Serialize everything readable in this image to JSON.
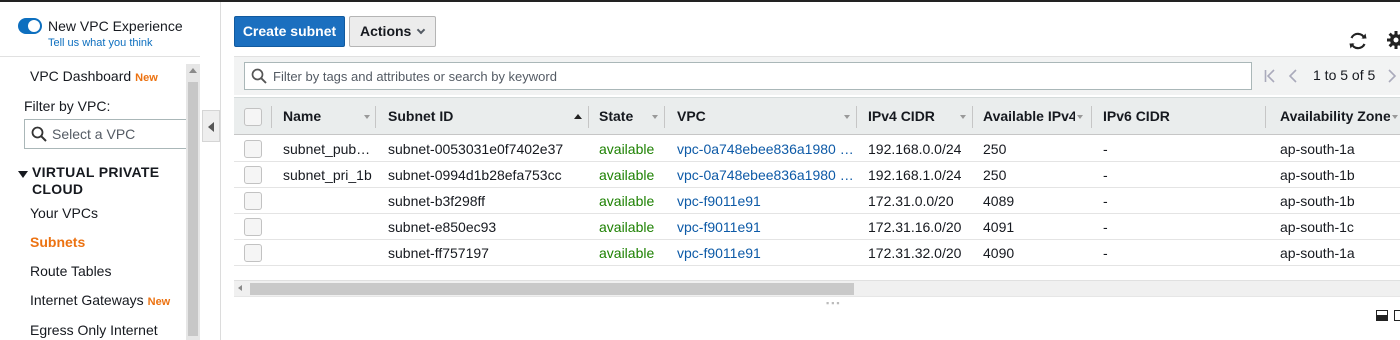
{
  "experience": {
    "title": "New VPC Experience",
    "feedback": "Tell us what you think"
  },
  "sidebar": {
    "dashboard": "VPC Dashboard",
    "dashboard_badge": "New",
    "filter_label": "Filter by VPC:",
    "filter_placeholder": "Select a VPC",
    "section": "VIRTUAL PRIVATE CLOUD",
    "items": [
      {
        "label": "Your VPCs",
        "badge": ""
      },
      {
        "label": "Subnets",
        "badge": "",
        "active": true
      },
      {
        "label": "Route Tables",
        "badge": ""
      },
      {
        "label": "Internet Gateways",
        "badge": "New"
      },
      {
        "label": "Egress Only Internet",
        "badge": ""
      }
    ]
  },
  "toolbar": {
    "create_label": "Create subnet",
    "actions_label": "Actions"
  },
  "search": {
    "placeholder": "Filter by tags and attributes or search by keyword"
  },
  "pagination": {
    "text": "1 to 5 of 5"
  },
  "table": {
    "columns": [
      "Name",
      "Subnet ID",
      "State",
      "VPC",
      "IPv4 CIDR",
      "Available IPv4",
      "IPv6 CIDR",
      "Availability Zone"
    ],
    "rows": [
      {
        "name": "subnet_pub…",
        "subnet_id": "subnet-0053031e0f7402e37",
        "state": "available",
        "vpc": "vpc-0a748ebee836a1980 …",
        "ipv4": "192.168.0.0/24",
        "avail": "250",
        "ipv6": "-",
        "az": "ap-south-1a"
      },
      {
        "name": "subnet_pri_1b",
        "subnet_id": "subnet-0994d1b28efa753cc",
        "state": "available",
        "vpc": "vpc-0a748ebee836a1980 …",
        "ipv4": "192.168.1.0/24",
        "avail": "250",
        "ipv6": "-",
        "az": "ap-south-1b"
      },
      {
        "name": "",
        "subnet_id": "subnet-b3f298ff",
        "state": "available",
        "vpc": "vpc-f9011e91",
        "ipv4": "172.31.0.0/20",
        "avail": "4089",
        "ipv6": "-",
        "az": "ap-south-1b"
      },
      {
        "name": "",
        "subnet_id": "subnet-e850ec93",
        "state": "available",
        "vpc": "vpc-f9011e91",
        "ipv4": "172.31.16.0/20",
        "avail": "4091",
        "ipv6": "-",
        "az": "ap-south-1c"
      },
      {
        "name": "",
        "subnet_id": "subnet-ff757197",
        "state": "available",
        "vpc": "vpc-f9011e91",
        "ipv4": "172.31.32.0/20",
        "avail": "4090",
        "ipv6": "-",
        "az": "ap-south-1a"
      }
    ]
  },
  "colors": {
    "primary": "#1b6fbf",
    "active_nav": "#ec7211",
    "state_available": "#1d8102",
    "link": "#0d5aa7",
    "toggle": "#0d6fbf"
  },
  "icons": [
    "toggle-switch",
    "search-icon",
    "refresh-icon",
    "gear-icon",
    "first-page-icon",
    "prev-page-icon",
    "next-page-icon",
    "collapse-icon",
    "panel-icon"
  ]
}
